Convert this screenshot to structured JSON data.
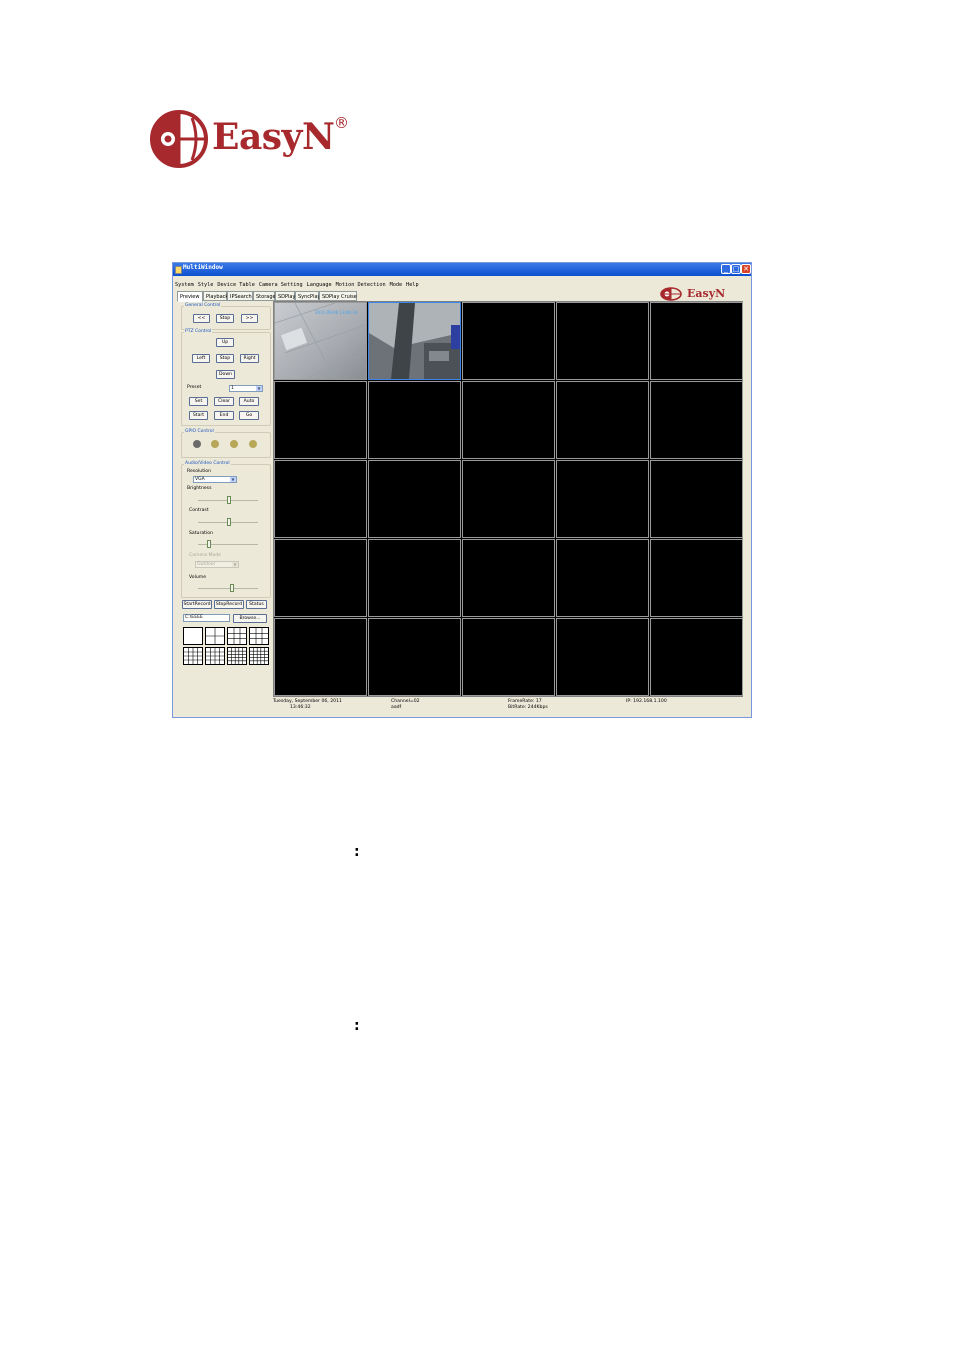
{
  "logo": {
    "brand": "EasyN",
    "registered": "®"
  },
  "window": {
    "title": "MultiWindow",
    "controls": {
      "minimize": "_",
      "maximize": "□",
      "close": "✕"
    },
    "menu": [
      "System",
      "Style",
      "Device Table",
      "Camera Setting",
      "Language",
      "Motion Detection",
      "Mode",
      "Help"
    ],
    "tabs": [
      "Preview",
      "Playback",
      "IPSearch",
      "Storage",
      "SDPlay",
      "SyncPlay",
      "SDPlay Cruise"
    ],
    "active_tab": "Preview",
    "brand": "EasyN"
  },
  "general_control": {
    "label": "General Control",
    "prev": "<<",
    "stop": "Stop",
    "next": ">>"
  },
  "ptz_control": {
    "label": "PTZ Control",
    "up": "Up",
    "left": "Left",
    "stop": "Stop",
    "right": "Right",
    "down": "Down",
    "preset_label": "Preset",
    "preset_value": "1",
    "set": "Set",
    "clear": "Clear",
    "auto": "Auto",
    "start": "Start",
    "end": "End",
    "go": "Go"
  },
  "gpio_control": {
    "label": "GPIO Control",
    "colors": [
      "#6b6b6b",
      "#b8a659",
      "#b8a659",
      "#b8a659"
    ]
  },
  "av_control": {
    "label": "Audio/Video Control",
    "resolution_label": "Resolution",
    "resolution_value": "VGA",
    "brightness_label": "Brightness",
    "brightness_value": 0.5,
    "contrast_label": "Contrast",
    "contrast_value": 0.5,
    "saturation_label": "Saturation",
    "saturation_value": 0.15,
    "camera_mode_label": "Camera Mode",
    "camera_mode_value": "Outdoor",
    "volume_label": "Volume",
    "volume_value": 0.55
  },
  "record": {
    "start": "StartRecord",
    "stop": "StopRecord",
    "status": "Status",
    "path": "C:\\EEEE",
    "browse": "Browse..."
  },
  "layouts": [
    "1",
    "4",
    "6",
    "9",
    "13",
    "16",
    "20",
    "25"
  ],
  "grid": {
    "rows": 5,
    "cols": 5,
    "feeds": [
      "ceiling-feed",
      "office-feed"
    ],
    "overlay": "2011-09-06 13:46:34"
  },
  "status_bar": {
    "date": "Tuesday, September 06, 2011",
    "time": "13:46:32",
    "channel": "Channel=02",
    "channel_name": "aadf",
    "framerate": "FrameRate: 17",
    "bitrate": "BitRate: 244Kbps",
    "ip": "IP: 192.168.1.100"
  },
  "page_marks": {
    "colon1": ":",
    "colon2": ":"
  }
}
